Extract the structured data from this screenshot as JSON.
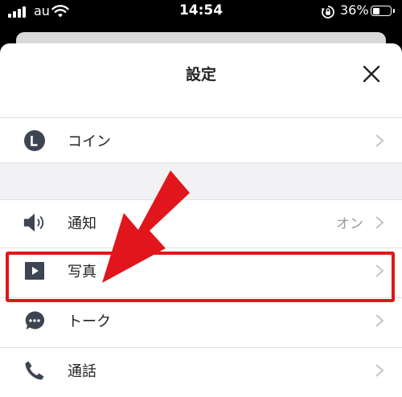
{
  "status_bar": {
    "carrier": "au",
    "time": "14:54",
    "battery": "36%"
  },
  "sheet": {
    "title": "設定"
  },
  "rows": [
    {
      "label": "コイン",
      "icon": "coin-icon"
    },
    {
      "label": "通知",
      "value": "オン",
      "icon": "speaker-icon"
    },
    {
      "label": "写真",
      "icon": "play-square-icon"
    },
    {
      "label": "トーク",
      "icon": "chat-bubble-icon"
    },
    {
      "label": "通話",
      "icon": "phone-icon"
    }
  ],
  "colors": {
    "highlight": "#e0161c",
    "icon": "#3d4452",
    "chevron": "#c4c4c4"
  }
}
